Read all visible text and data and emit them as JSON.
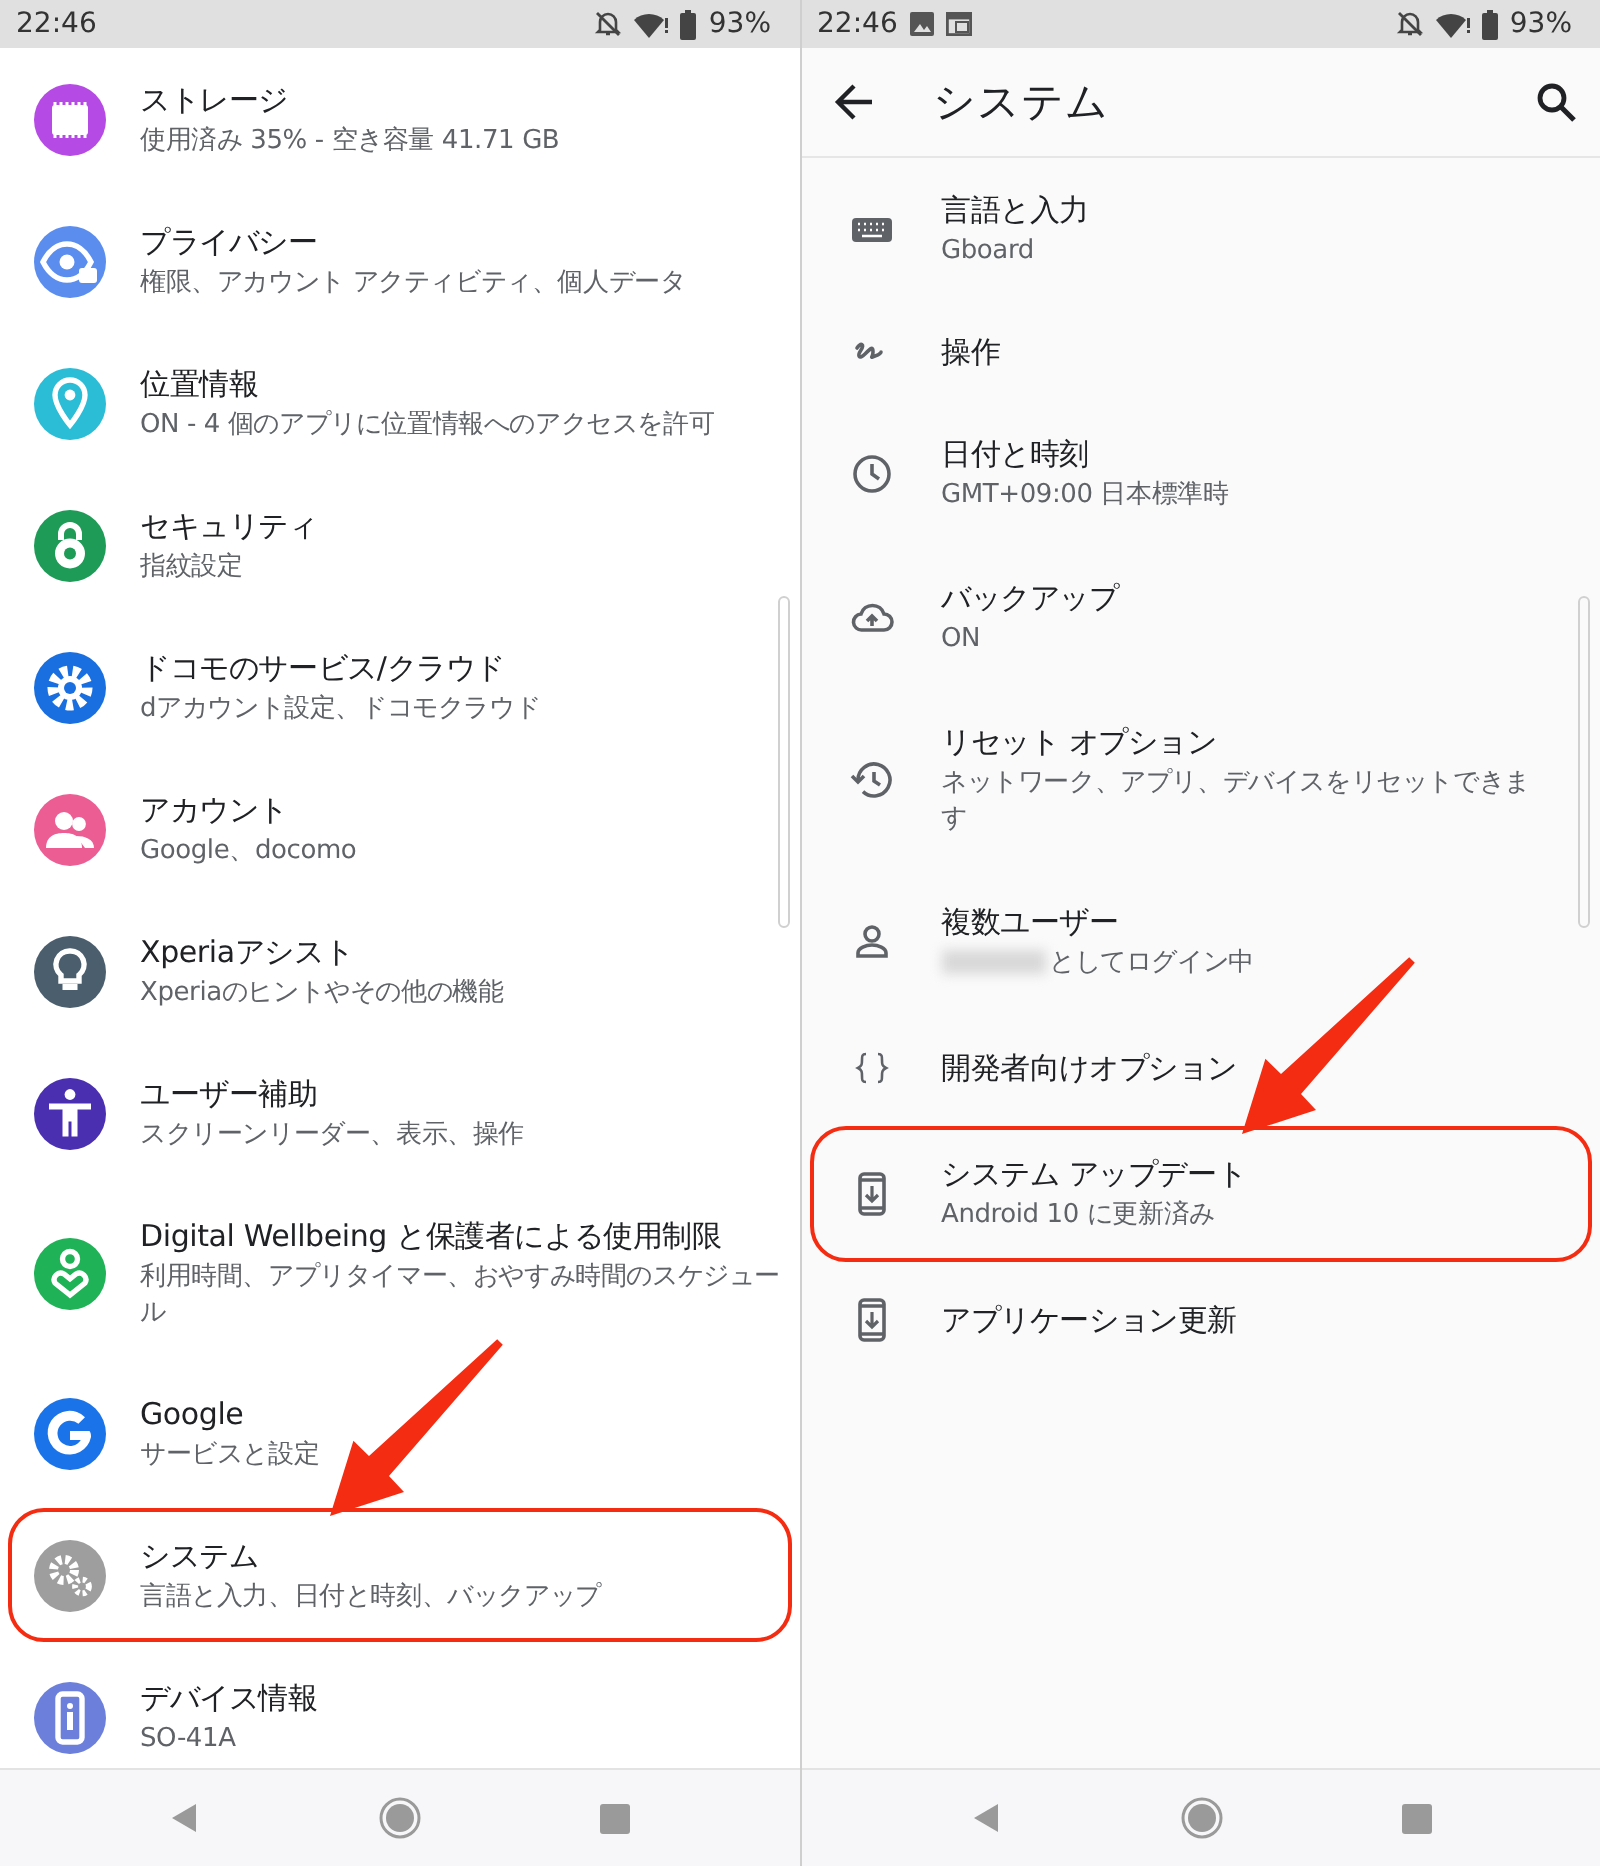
{
  "screens": [
    {
      "status_bar": {
        "time": "22:46",
        "battery": "93%",
        "has_notifications": false
      },
      "items": [
        {
          "title": "ストレージ",
          "subtitle": "使用済み 35% - 空き容量 41.71 GB",
          "color": "#b54ae4",
          "highlighted": false
        },
        {
          "title": "プライバシー",
          "subtitle": "権限、アカウント アクティビティ、個人データ",
          "color": "#5b8def",
          "highlighted": false
        },
        {
          "title": "位置情報",
          "subtitle": "ON - 4 個のアプリに位置情報へのアクセスを許可",
          "color": "#2bbcd6",
          "highlighted": false
        },
        {
          "title": "セキュリティ",
          "subtitle": "指紋設定",
          "color": "#1e9b56",
          "highlighted": false
        },
        {
          "title": "ドコモのサービス/クラウド",
          "subtitle": "dアカウント設定、ドコモクラウド",
          "color": "#1a6fe0",
          "highlighted": false
        },
        {
          "title": "アカウント",
          "subtitle": "Google、docomo",
          "color": "#ec5d94",
          "highlighted": false
        },
        {
          "title": "Xperiaアシスト",
          "subtitle": "Xperiaのヒントやその他の機能",
          "color": "#4b5e6e",
          "highlighted": false
        },
        {
          "title": "ユーザー補助",
          "subtitle": "スクリーンリーダー、表示、操作",
          "color": "#4a2fb0",
          "highlighted": false
        },
        {
          "title": "Digital Wellbeing と保護者による使用制限",
          "subtitle": "利用時間、アプリタイマー、おやすみ時間のスケジュール",
          "color": "#1fb256",
          "highlighted": false
        },
        {
          "title": "Google",
          "subtitle": "サービスと設定",
          "color": "#1a73e8",
          "highlighted": false
        },
        {
          "title": "システム",
          "subtitle": "言語と入力、日付と時刻、バックアップ",
          "color": "#9e9e9e",
          "highlighted": true
        },
        {
          "title": "デバイス情報",
          "subtitle": "SO-41A",
          "color": "#6b7fdb",
          "highlighted": false
        }
      ]
    },
    {
      "status_bar": {
        "time": "22:46",
        "battery": "93%",
        "has_notifications": true
      },
      "app_bar": {
        "title": "システム"
      },
      "items": [
        {
          "title": "言語と入力",
          "subtitle": "Gboard",
          "highlighted": false
        },
        {
          "title": "操作",
          "highlighted": false
        },
        {
          "title": "日付と時刻",
          "subtitle": "GMT+09:00 日本標準時",
          "highlighted": false
        },
        {
          "title": "バックアップ",
          "subtitle": "ON",
          "highlighted": false
        },
        {
          "title": "リセット オプション",
          "subtitle": "ネットワーク、アプリ、デバイスをリセットできます",
          "highlighted": false
        },
        {
          "title": "複数ユーザー",
          "subtitle": "としてログイン中",
          "redacted_prefix": true,
          "highlighted": false
        },
        {
          "title": "開発者向けオプション",
          "highlighted": false
        },
        {
          "title": "システム アップデート",
          "subtitle": "Android 10 に更新済み",
          "highlighted": true
        },
        {
          "title": "アプリケーション更新",
          "highlighted": false
        }
      ]
    }
  ]
}
